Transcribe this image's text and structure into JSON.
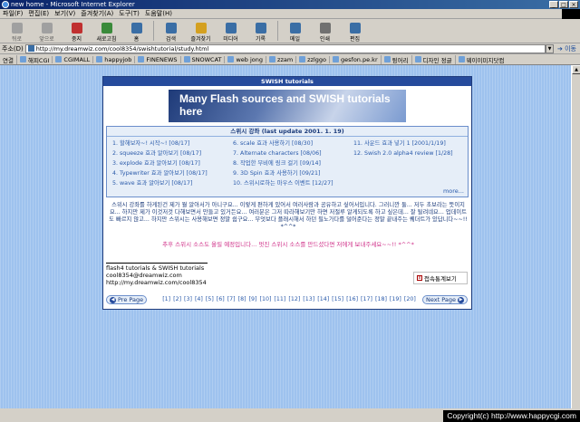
{
  "window": {
    "title": "new home - Microsoft Internet Explorer"
  },
  "menu": [
    "파일(F)",
    "편집(E)",
    "보기(V)",
    "즐겨찾기(A)",
    "도구(T)",
    "도움말(H)"
  ],
  "toolbar": [
    {
      "label": "뒤로",
      "icon": "back-arrow-icon",
      "color": "#a0a0a0"
    },
    {
      "label": "앞으로",
      "icon": "forward-arrow-icon",
      "color": "#a0a0a0"
    },
    {
      "label": "중지",
      "icon": "stop-icon",
      "color": "#c03030"
    },
    {
      "label": "새로고침",
      "icon": "refresh-icon",
      "color": "#3a8a3a"
    },
    {
      "label": "홈",
      "icon": "home-icon",
      "color": "#3a6ea5"
    },
    {
      "label": "검색",
      "icon": "search-icon",
      "color": "#3a6ea5"
    },
    {
      "label": "즐겨찾기",
      "icon": "favorites-icon",
      "color": "#d4a020"
    },
    {
      "label": "미디어",
      "icon": "media-icon",
      "color": "#3a6ea5"
    },
    {
      "label": "기록",
      "icon": "history-icon",
      "color": "#3a6ea5"
    },
    {
      "label": "메일",
      "icon": "mail-icon",
      "color": "#3a6ea5"
    },
    {
      "label": "인쇄",
      "icon": "print-icon",
      "color": "#707070"
    },
    {
      "label": "편집",
      "icon": "edit-icon",
      "color": "#3a6ea5"
    }
  ],
  "address": {
    "label": "주소(D)",
    "url": "http://my.dreamwiz.com/cool8354/swishtutorial/study.html",
    "go": "이동"
  },
  "links": {
    "label": "연결",
    "items": [
      "해피CGI",
      "CGIMALL",
      "happyjob",
      "FINENEWS",
      "SNOWCAT",
      "web jong",
      "zzam",
      "zzlggo",
      "gesfon.pe.kr",
      "뒹어리",
      "디자인 정글",
      "웨이이미지닷컴"
    ]
  },
  "panel": {
    "header": "SWISH tutorials",
    "banner": "Many Flash sources and SWISH tutorials here"
  },
  "lessons": {
    "title": "스위시 강좌 (last update 2001. 1. 19)",
    "items": [
      "1. 할해보자~! 시작~! [08/17]",
      "6. scale 효과 사용하기 [08/30]",
      "11. 사운드 효과 넣기 1 [2001/1/19]",
      "2. squeeze 효과 알아보기 [08/17]",
      "7. Alternate characters [08/06]",
      "12. Swish 2.0 alpha4 review [1/28]",
      "3. explode 효과 알아보기 [08/17]",
      "8. 작업한 무비에 링크 걸기 [09/14]",
      "",
      "4. Typewriter 효과 알아보기 [08/17]",
      "9. 3D Spin 효과 사용하기 [09/21]",
      "",
      "5. wave 효과 알아보기 [08/17]",
      "10. 스위시로하는 마우스 이벤트 [12/27]",
      ""
    ],
    "more": "more..."
  },
  "description": "스위시 강좌를 하게된건 제가 뭘 알아서가 아니구요... 이렇게 편하게 있어서 여러사람과 공유하고 싶어서입니다. 그러니깐 둘... 저두 초보라는 뜻이지요... 하지만 제가 이것저것 다해보면서 만들고 있거든요... 여러분은 그저 따라해보기만 하면 저절루 알게되도록 하고 싶은데... 잘 될려네요... 업데이트도 빠르지 않고... 하지만 스위시는 사용해보면 정말 쉽구요... 무엇보다 플래시해서 하던 필노가다를 덜어준다는 정말 끝내주는 퀘더트가 있답니다~~!! *^^*",
  "notice": "추후 스위시 소스도 올릴 예정입니다... 멋진 스위시 소스를 만드셨다면 저에게 보내주세요~~!! *^^*",
  "credits": {
    "line1": "flash4 tutorials & SWISH tutorials",
    "line2": "cool8354@dreamwiz.com",
    "line3": "http://my.dreamwiz.com/cool8354"
  },
  "counter": {
    "label": "접속통계보기"
  },
  "pagination": {
    "prev": "Pre Page",
    "next": "Next Page",
    "pages": [
      "[1]",
      "[2]",
      "[3]",
      "[4]",
      "[5]",
      "[6]",
      "[7]",
      "[8]",
      "[9]",
      "[10]",
      "[11]",
      "[12]",
      "[13]",
      "[14]",
      "[15]",
      "[16]",
      "[17]",
      "[18]",
      "[19]",
      "[20]"
    ]
  },
  "watermark": "Copyright(c) http://www.happycgi.com"
}
